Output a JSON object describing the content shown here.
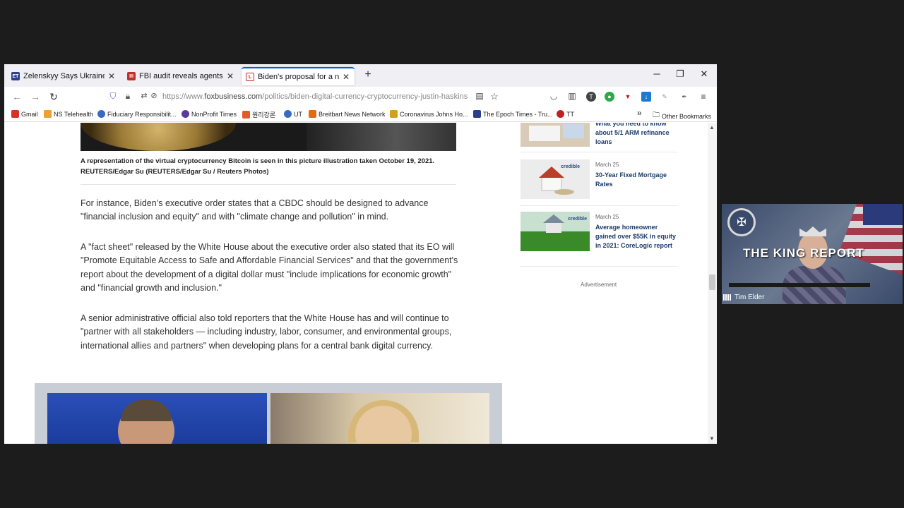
{
  "tabs": [
    {
      "label": "Zelenskyy Says Ukraine Will Insi",
      "favicon": "ET",
      "favicon_color": "#2a3f8f"
    },
    {
      "label": "FBI audit reveals agents' rule-br",
      "favicon": "III",
      "favicon_color": "#c0302a"
    },
    {
      "label": "Biden's proposal for a new digit",
      "favicon": "L",
      "favicon_color": "#c0302a",
      "active": true
    }
  ],
  "toolbar": {
    "new_tab": "+",
    "url_prefix": "https://www.",
    "url_domain": "foxbusiness.com",
    "url_path": "/politics/biden-digital-currency-cryptocurrency-justin-haskins"
  },
  "bookmarks": [
    {
      "label": "Gmail",
      "color": "#d93025"
    },
    {
      "label": "NS Telehealth",
      "color": "#f0a030"
    },
    {
      "label": "Fiduciary Responsibilit...",
      "color": "#3a6ac0"
    },
    {
      "label": "NonProfit Times",
      "color": "#5a3a9a"
    },
    {
      "label": "원리강론",
      "color": "#e05a2a"
    },
    {
      "label": "UT",
      "color": "#3a6ac0"
    },
    {
      "label": "Breitbart News Network",
      "color": "#e06a1a"
    },
    {
      "label": "Coronavirus Johns Ho...",
      "color": "#d0a020"
    },
    {
      "label": "The Epoch Times - Tru...",
      "color": "#2a3f8f"
    },
    {
      "label": "TT",
      "color": "#c02020"
    }
  ],
  "bookmarks_more": "»",
  "other_bookmarks": "Other Bookmarks",
  "article": {
    "caption": "A representation of the virtual cryptocurrency Bitcoin is seen in this picture illustration taken October 19, 2021. REUTERS/Edgar Su (REUTERS/Edgar Su / Reuters Photos)",
    "paragraphs": [
      "For instance, Biden’s executive order states that a CBDC should be designed to advance \"financial inclusion and equity\" and with \"climate change and pollution\" in mind.",
      "A \"fact sheet\" released by the White House about the executive order also stated that its EO will \"Promote Equitable Access to Safe and Affordable Financial Services\" and that the government's report about the development of a digital dollar must \"include implications for economic growth\" and \"financial growth and inclusion.\"",
      "A senior administrative official also told reporters that the White House has and will continue to \"partner with all stakeholders — including industry, labor, consumer, and environmental groups, international allies and partners\" when developing plans for a central bank digital currency."
    ]
  },
  "sidebar": {
    "items": [
      {
        "date": "",
        "title": "What you need to know about 5/1 ARM refinance loans"
      },
      {
        "date": "March 25",
        "title": "30-Year Fixed Mortgage Rates",
        "sponsor": "credible"
      },
      {
        "date": "March 25",
        "title": "Average homeowner gained over $55K in equity in 2021: CoreLogic report",
        "sponsor": "credible"
      }
    ],
    "ad_label": "Advertisement"
  },
  "webcam": {
    "brand": "THE KING REPORT",
    "name": "Tim Elder"
  }
}
